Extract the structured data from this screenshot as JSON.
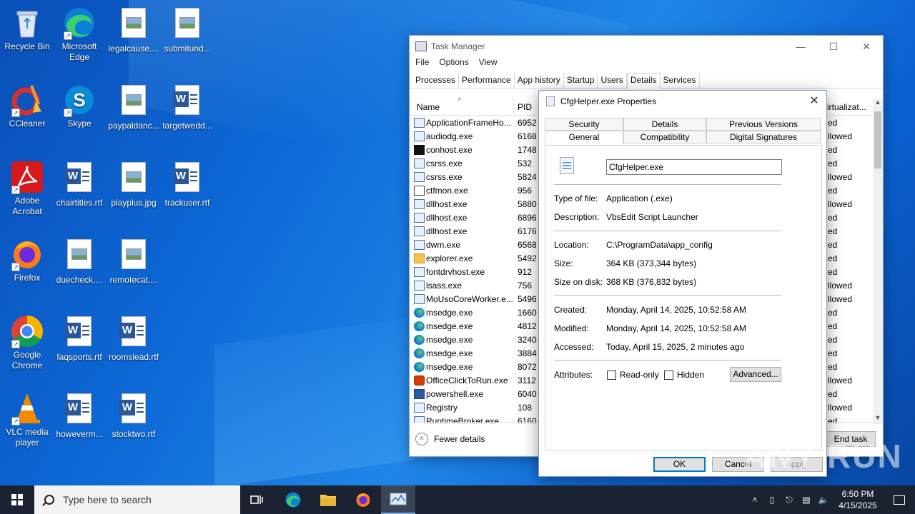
{
  "desktop": {
    "icons": [
      {
        "label": "Recycle Bin"
      },
      {
        "label": "Microsoft Edge"
      },
      {
        "label": "legalcause...."
      },
      {
        "label": "submitund..."
      },
      {
        "label": "CCleaner"
      },
      {
        "label": "Skype"
      },
      {
        "label": "paypaldanc..."
      },
      {
        "label": "targetwedd..."
      },
      {
        "label": "Adobe Acrobat"
      },
      {
        "label": "chairtitles.rtf"
      },
      {
        "label": "playplus.jpg"
      },
      {
        "label": "trackuser.rtf"
      },
      {
        "label": "Firefox"
      },
      {
        "label": "duecheck...."
      },
      {
        "label": "remotecat...."
      },
      {
        "label": "Google Chrome"
      },
      {
        "label": "faqsports.rtf"
      },
      {
        "label": "roomslead.rtf"
      },
      {
        "label": "VLC media player"
      },
      {
        "label": "howeverm..."
      },
      {
        "label": "stocktwo.rtf"
      }
    ]
  },
  "task_manager": {
    "title": "Task Manager",
    "menu": [
      "File",
      "Options",
      "View"
    ],
    "tabs": [
      "Processes",
      "Performance",
      "App history",
      "Startup",
      "Users",
      "Details",
      "Services"
    ],
    "active_tab": "Details",
    "columns": {
      "name": "Name",
      "pid": "PID",
      "virt": "irtualizat..."
    },
    "rows": [
      {
        "name": "ApplicationFrameHo...",
        "pid": "6952",
        "virt": "ed",
        "icon": "window-icon"
      },
      {
        "name": "audiodg.exe",
        "pid": "6168",
        "virt": "llowed",
        "icon": "window-icon"
      },
      {
        "name": "conhost.exe",
        "pid": "1748",
        "virt": "ed",
        "icon": "console-icon"
      },
      {
        "name": "csrss.exe",
        "pid": "532",
        "virt": "ed",
        "icon": "window-icon"
      },
      {
        "name": "csrss.exe",
        "pid": "5824",
        "virt": "llowed",
        "icon": "window-icon"
      },
      {
        "name": "ctfmon.exe",
        "pid": "956",
        "virt": "ed",
        "icon": "pen-icon"
      },
      {
        "name": "dllhost.exe",
        "pid": "5880",
        "virt": "llowed",
        "icon": "window-icon"
      },
      {
        "name": "dllhost.exe",
        "pid": "6896",
        "virt": "ed",
        "icon": "window-icon"
      },
      {
        "name": "dllhost.exe",
        "pid": "6176",
        "virt": "ed",
        "icon": "window-icon"
      },
      {
        "name": "dwm.exe",
        "pid": "6568",
        "virt": "ed",
        "icon": "window-icon"
      },
      {
        "name": "explorer.exe",
        "pid": "5492",
        "virt": "ed",
        "icon": "folder-icon"
      },
      {
        "name": "fontdrvhost.exe",
        "pid": "912",
        "virt": "ed",
        "icon": "window-icon"
      },
      {
        "name": "lsass.exe",
        "pid": "756",
        "virt": "llowed",
        "icon": "window-icon"
      },
      {
        "name": "MoUsoCoreWorker.e...",
        "pid": "5496",
        "virt": "llowed",
        "icon": "window-icon"
      },
      {
        "name": "msedge.exe",
        "pid": "1660",
        "virt": "ed",
        "icon": "edge-icon"
      },
      {
        "name": "msedge.exe",
        "pid": "4812",
        "virt": "ed",
        "icon": "edge-icon"
      },
      {
        "name": "msedge.exe",
        "pid": "3240",
        "virt": "ed",
        "icon": "edge-icon"
      },
      {
        "name": "msedge.exe",
        "pid": "3884",
        "virt": "ed",
        "icon": "edge-icon"
      },
      {
        "name": "msedge.exe",
        "pid": "8072",
        "virt": "ed",
        "icon": "edge-icon"
      },
      {
        "name": "OfficeClickToRun.exe",
        "pid": "3112",
        "virt": "llowed",
        "icon": "office-icon"
      },
      {
        "name": "powershell.exe",
        "pid": "6040",
        "virt": "ed",
        "icon": "powershell-icon"
      },
      {
        "name": "Registry",
        "pid": "108",
        "virt": "llowed",
        "icon": "window-icon"
      },
      {
        "name": "RuntimeBroker.exe",
        "pid": "6160",
        "virt": "ed",
        "icon": "window-icon"
      }
    ],
    "fewer_details": "Fewer details",
    "end_task": "End task"
  },
  "properties": {
    "title": "CfgHelper.exe Properties",
    "tabs_row1": [
      "Security",
      "Details",
      "Previous Versions"
    ],
    "tabs_row2": [
      "General",
      "Compatibility",
      "Digital Signatures"
    ],
    "active_tab": "General",
    "filename": "CfgHelper.exe",
    "fields": {
      "type_label": "Type of file:",
      "type_value": "Application (.exe)",
      "desc_label": "Description:",
      "desc_value": "VbsEdit Script Launcher",
      "location_label": "Location:",
      "location_value": "C:\\ProgramData\\app_config",
      "size_label": "Size:",
      "size_value": "364 KB (373,344 bytes)",
      "sod_label": "Size on disk:",
      "sod_value": "368 KB (376,832 bytes)",
      "created_label": "Created:",
      "created_value": "Monday, April 14, 2025, 10:52:58 AM",
      "modified_label": "Modified:",
      "modified_value": "Monday, April 14, 2025, 10:52:58 AM",
      "accessed_label": "Accessed:",
      "accessed_value": "Today, April 15, 2025, 2 minutes ago",
      "attr_label": "Attributes:"
    },
    "readonly": "Read-only",
    "hidden": "Hidden",
    "advanced": "Advanced...",
    "ok": "OK",
    "cancel": "Cancel",
    "apply": "Apply"
  },
  "watermark": "ANY RUN",
  "taskbar": {
    "search_placeholder": "Type here to search",
    "time": "6:50 PM",
    "date": "4/15/2025"
  }
}
